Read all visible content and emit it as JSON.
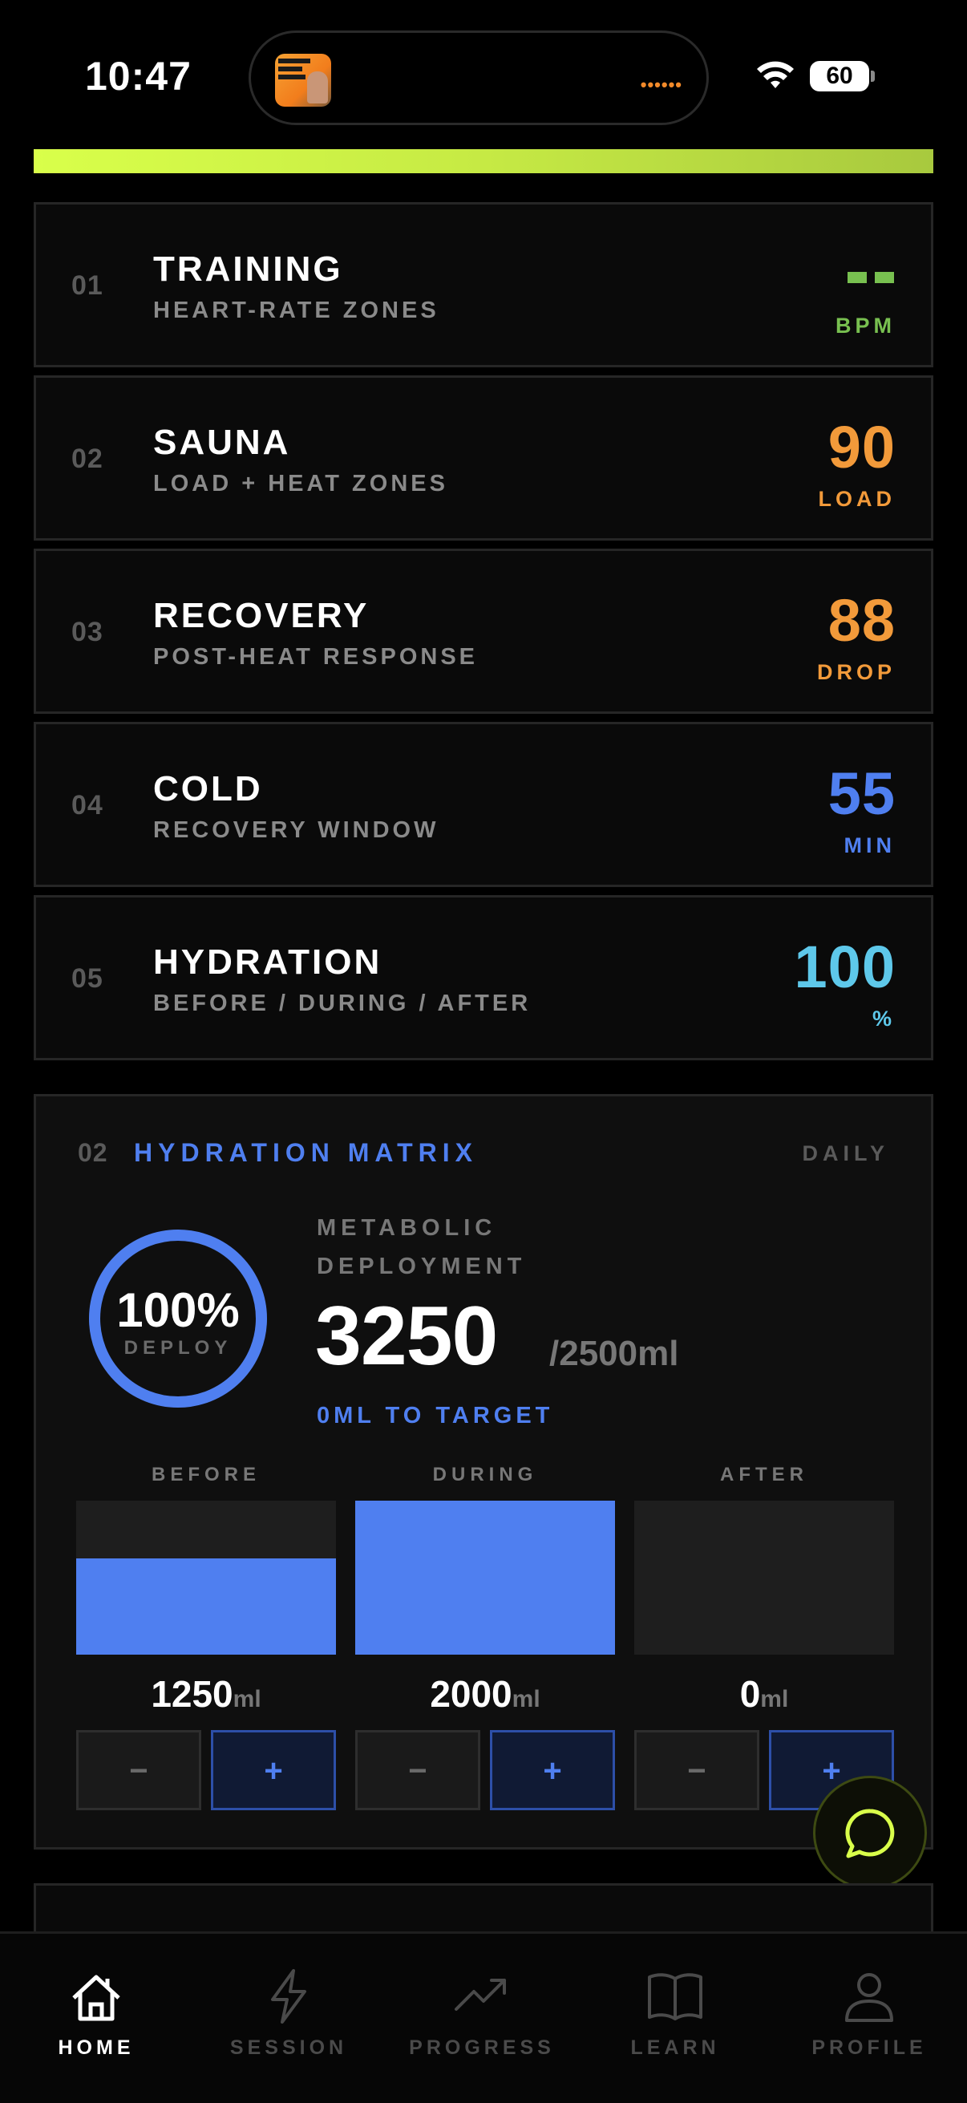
{
  "status": {
    "time": "10:47",
    "battery": "60"
  },
  "metrics": [
    {
      "num": "01",
      "title": "TRAINING",
      "subtitle": "HEART-RATE ZONES",
      "value": "",
      "unit": "BPM",
      "color": "#78c050"
    },
    {
      "num": "02",
      "title": "SAUNA",
      "subtitle": "LOAD + HEAT ZONES",
      "value": "90",
      "unit": "LOAD",
      "color": "#f29a3a"
    },
    {
      "num": "03",
      "title": "RECOVERY",
      "subtitle": "POST-HEAT RESPONSE",
      "value": "88",
      "unit": "DROP",
      "color": "#f29a3a"
    },
    {
      "num": "04",
      "title": "COLD",
      "subtitle": "RECOVERY WINDOW",
      "value": "55",
      "unit": "MIN",
      "color": "#4f7ff0"
    },
    {
      "num": "05",
      "title": "HYDRATION",
      "subtitle": "BEFORE / DURING / AFTER",
      "value": "100",
      "unit": "%",
      "color": "#5ec8ea"
    }
  ],
  "hydration": {
    "num": "02",
    "title": "HYDRATION MATRIX",
    "period": "DAILY",
    "ring_pct": "100%",
    "ring_progress": 1.0,
    "ring_label": "DEPLOY",
    "meta_label": "METABOLIC DEPLOYMENT",
    "total": "3250",
    "target": "/2500ml",
    "to_target": "0ML TO TARGET",
    "columns": [
      {
        "label": "BEFORE",
        "value": "1250",
        "unit": "ml",
        "fill": 0.625,
        "minus": "−",
        "plus": "+"
      },
      {
        "label": "DURING",
        "value": "2000",
        "unit": "ml",
        "fill": 1.0,
        "minus": "−",
        "plus": "+"
      },
      {
        "label": "AFTER",
        "value": "0",
        "unit": "ml",
        "fill": 0.0,
        "minus": "−",
        "plus": "+"
      }
    ]
  },
  "nav": [
    {
      "label": "HOME",
      "icon": "home-icon",
      "active": true
    },
    {
      "label": "SESSION",
      "icon": "lightning-icon",
      "active": false
    },
    {
      "label": "PROGRESS",
      "icon": "trend-up-icon",
      "active": false
    },
    {
      "label": "LEARN",
      "icon": "book-icon",
      "active": false
    },
    {
      "label": "PROFILE",
      "icon": "person-icon",
      "active": false
    }
  ],
  "colors": {
    "accent": "#4f7ff0",
    "lime": "#d9ff4a",
    "active_nav": "#ffffff",
    "inactive_nav": "#4a4a4a"
  }
}
